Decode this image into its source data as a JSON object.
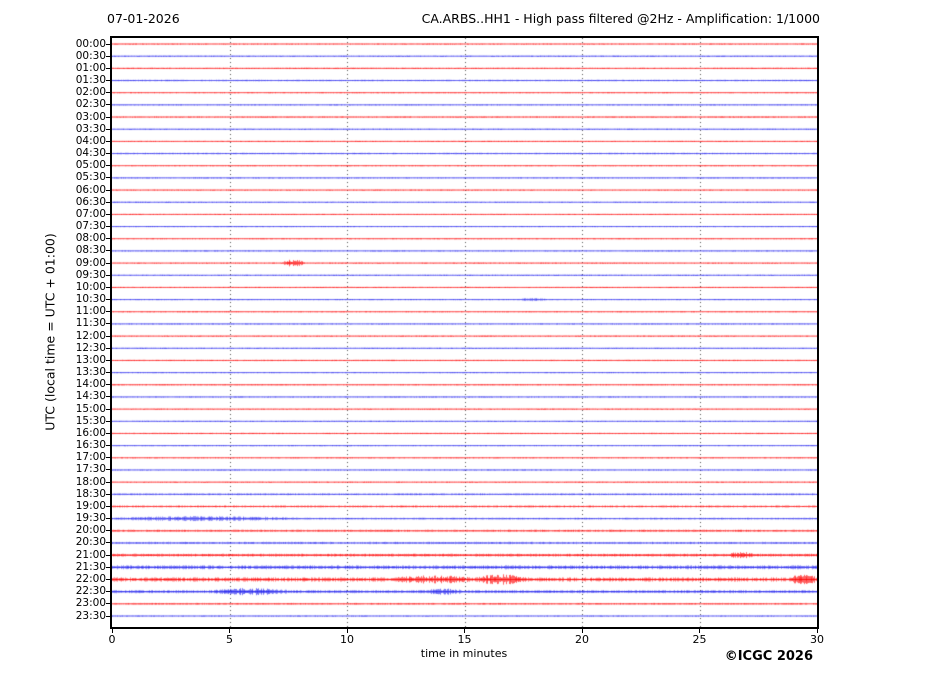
{
  "header": {
    "date": "07-01-2026",
    "title": "CA.ARBS..HH1 - High pass filtered @2Hz - Amplification: 1/1000"
  },
  "axes": {
    "y_label": "UTC (local time = UTC + 01:00)",
    "x_label": "time in minutes"
  },
  "footer": {
    "copyright": "©ICGC 2026"
  },
  "chart_data": {
    "type": "helicorder-seismogram",
    "title": "CA.ARBS..HH1 - High pass filtered @2Hz - Amplification: 1/1000",
    "date": "07-01-2026",
    "xlabel": "time in minutes",
    "ylabel": "UTC (local time = UTC + 01:00)",
    "x": {
      "min": 0,
      "max": 30,
      "ticks": [
        0,
        5,
        10,
        15,
        20,
        25,
        30
      ],
      "gridlines": [
        5,
        10,
        15,
        20,
        25
      ]
    },
    "minutes_per_row": 30,
    "trace_colors": {
      "red": "#ff0000",
      "blue": "#2222ee"
    },
    "grid_color": "#555555",
    "rows": [
      {
        "label": "00:00",
        "color": "red",
        "noise": 0.5,
        "events": []
      },
      {
        "label": "00:30",
        "color": "blue",
        "noise": 0.5,
        "events": []
      },
      {
        "label": "01:00",
        "color": "red",
        "noise": 0.6,
        "events": []
      },
      {
        "label": "01:30",
        "color": "blue",
        "noise": 0.7,
        "events": []
      },
      {
        "label": "02:00",
        "color": "red",
        "noise": 0.5,
        "events": []
      },
      {
        "label": "02:30",
        "color": "blue",
        "noise": 0.5,
        "events": []
      },
      {
        "label": "03:00",
        "color": "red",
        "noise": 0.6,
        "events": []
      },
      {
        "label": "03:30",
        "color": "blue",
        "noise": 0.5,
        "events": []
      },
      {
        "label": "04:00",
        "color": "red",
        "noise": 0.5,
        "events": []
      },
      {
        "label": "04:30",
        "color": "blue",
        "noise": 0.7,
        "events": []
      },
      {
        "label": "05:00",
        "color": "red",
        "noise": 0.5,
        "events": []
      },
      {
        "label": "05:30",
        "color": "blue",
        "noise": 0.5,
        "events": []
      },
      {
        "label": "06:00",
        "color": "red",
        "noise": 0.5,
        "events": []
      },
      {
        "label": "06:30",
        "color": "blue",
        "noise": 0.5,
        "events": []
      },
      {
        "label": "07:00",
        "color": "red",
        "noise": 0.5,
        "events": []
      },
      {
        "label": "07:30",
        "color": "blue",
        "noise": 0.5,
        "events": []
      },
      {
        "label": "08:00",
        "color": "red",
        "noise": 0.5,
        "events": []
      },
      {
        "label": "08:30",
        "color": "blue",
        "noise": 0.5,
        "events": []
      },
      {
        "label": "09:00",
        "color": "red",
        "noise": 0.5,
        "events": [
          {
            "start": 7.2,
            "end": 8.2,
            "amp": 2.5
          }
        ]
      },
      {
        "label": "09:30",
        "color": "blue",
        "noise": 0.5,
        "events": []
      },
      {
        "label": "10:00",
        "color": "red",
        "noise": 0.5,
        "events": []
      },
      {
        "label": "10:30",
        "color": "blue",
        "noise": 0.5,
        "events": [
          {
            "start": 17.3,
            "end": 18.5,
            "amp": 0.9
          }
        ]
      },
      {
        "label": "11:00",
        "color": "red",
        "noise": 0.5,
        "events": []
      },
      {
        "label": "11:30",
        "color": "blue",
        "noise": 0.5,
        "events": []
      },
      {
        "label": "12:00",
        "color": "red",
        "noise": 0.5,
        "events": []
      },
      {
        "label": "12:30",
        "color": "blue",
        "noise": 0.5,
        "events": []
      },
      {
        "label": "13:00",
        "color": "red",
        "noise": 0.6,
        "events": []
      },
      {
        "label": "13:30",
        "color": "blue",
        "noise": 0.5,
        "events": []
      },
      {
        "label": "14:00",
        "color": "red",
        "noise": 0.6,
        "events": []
      },
      {
        "label": "14:30",
        "color": "blue",
        "noise": 0.5,
        "events": []
      },
      {
        "label": "15:00",
        "color": "red",
        "noise": 0.5,
        "events": []
      },
      {
        "label": "15:30",
        "color": "blue",
        "noise": 0.5,
        "events": []
      },
      {
        "label": "16:00",
        "color": "red",
        "noise": 0.6,
        "events": []
      },
      {
        "label": "16:30",
        "color": "blue",
        "noise": 0.5,
        "events": []
      },
      {
        "label": "17:00",
        "color": "red",
        "noise": 0.5,
        "events": []
      },
      {
        "label": "17:30",
        "color": "blue",
        "noise": 0.5,
        "events": []
      },
      {
        "label": "18:00",
        "color": "red",
        "noise": 0.5,
        "events": []
      },
      {
        "label": "18:30",
        "color": "blue",
        "noise": 0.8,
        "events": []
      },
      {
        "label": "19:00",
        "color": "red",
        "noise": 0.9,
        "events": []
      },
      {
        "label": "19:30",
        "color": "blue",
        "noise": 0.8,
        "events": [
          {
            "start": 0,
            "end": 8,
            "amp": 1.2
          }
        ]
      },
      {
        "label": "20:00",
        "color": "red",
        "noise": 1.0,
        "events": []
      },
      {
        "label": "20:30",
        "color": "blue",
        "noise": 1.0,
        "events": []
      },
      {
        "label": "21:00",
        "color": "red",
        "noise": 1.2,
        "events": [
          {
            "start": 26.2,
            "end": 27.3,
            "amp": 1.6
          }
        ]
      },
      {
        "label": "21:30",
        "color": "blue",
        "noise": 1.6,
        "events": []
      },
      {
        "label": "22:00",
        "color": "red",
        "noise": 1.7,
        "events": [
          {
            "start": 12.0,
            "end": 15.3,
            "amp": 1.6
          },
          {
            "start": 15.5,
            "end": 17.6,
            "amp": 2.6
          },
          {
            "start": 28.8,
            "end": 30.0,
            "amp": 2.2
          }
        ]
      },
      {
        "label": "22:30",
        "color": "blue",
        "noise": 1.3,
        "events": [
          {
            "start": 4.2,
            "end": 7.5,
            "amp": 1.6
          },
          {
            "start": 13.4,
            "end": 14.9,
            "amp": 1.4
          }
        ]
      },
      {
        "label": "23:00",
        "color": "red",
        "noise": 0.8,
        "events": []
      },
      {
        "label": "23:30",
        "color": "blue",
        "noise": 0.5,
        "events": []
      }
    ]
  }
}
